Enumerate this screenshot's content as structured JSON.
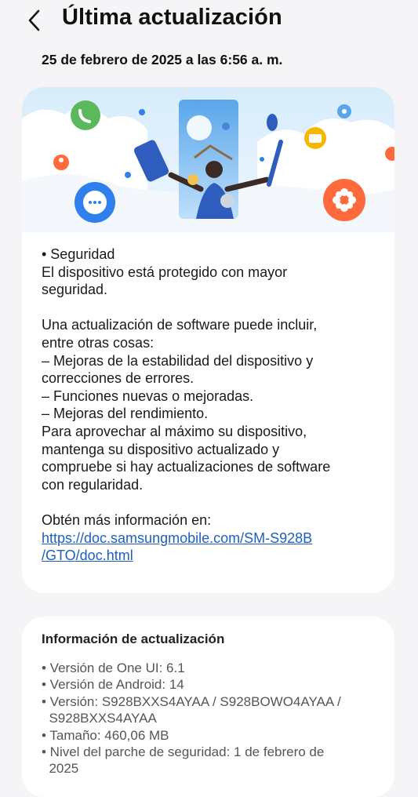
{
  "header": {
    "back_icon": "chevron-left-icon",
    "title": "Última actualización"
  },
  "update_date": "25 de febrero de 2025 a las 6:56 a. m.",
  "banner": {
    "icons": [
      "phone-icon",
      "chat-icon",
      "folder-icon",
      "gear-icon",
      "flower-icon",
      "person-icon"
    ],
    "accent_colors": [
      "#5cb85c",
      "#2f80ed",
      "#f5b800",
      "#ff6a3d",
      "#4a74d9"
    ]
  },
  "notes": {
    "lines": [
      "• Seguridad",
      "El dispositivo está protegido con mayor",
      "seguridad.",
      "",
      "Una actualización de software puede incluir,",
      "entre otras cosas:",
      " – Mejoras de la estabilidad del dispositivo y",
      "correcciones de errores.",
      " – Funciones nuevas o mejoradas.",
      " – Mejoras del rendimiento.",
      "Para aprovechar al máximo su dispositivo,",
      "mantenga su dispositivo actualizado y",
      "compruebe si hay actualizaciones de software",
      "con regularidad.",
      "",
      "Obtén más información en:"
    ],
    "link_lines": [
      "https://doc.samsungmobile.com/SM-S928B",
      "/GTO/doc.html"
    ],
    "link_color": "#1f5fbf"
  },
  "update_info": {
    "title": "Información de actualización",
    "items": [
      "• Versión de One UI: 6.1",
      "• Versión de Android: 14",
      "• Versión: S928BXXS4AYAA / S928BOWO4AYAA /",
      "  S928BXXS4AYAA",
      "• Tamaño: 460,06 MB",
      "• Nivel del parche de seguridad: 1 de febrero de",
      "  2025"
    ]
  }
}
